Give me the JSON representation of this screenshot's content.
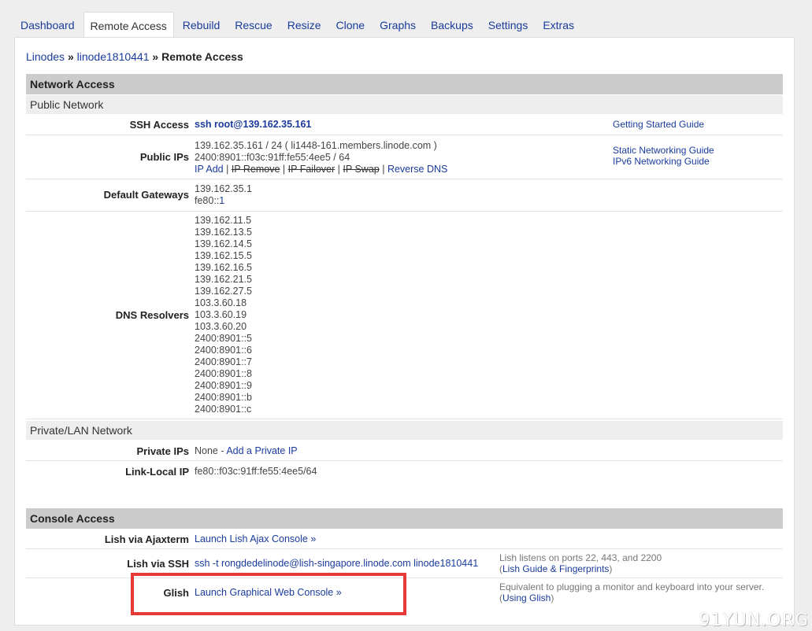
{
  "tabs": [
    "Dashboard",
    "Remote Access",
    "Rebuild",
    "Rescue",
    "Resize",
    "Clone",
    "Graphs",
    "Backups",
    "Settings",
    "Extras"
  ],
  "active_tab": "Remote Access",
  "breadcrumb": {
    "root": "Linodes",
    "sep1": "»",
    "linode": "linode1810441",
    "sep2": "»",
    "current": "Remote Access"
  },
  "network": {
    "header": "Network Access",
    "public_header": "Public Network",
    "ssh_access": {
      "label": "SSH Access",
      "value": "ssh root@139.162.35.161",
      "help": "Getting Started Guide"
    },
    "public_ips": {
      "label": "Public IPs",
      "ipv4": "139.162.35.161 / 24 ( li1448-161.members.linode.com )",
      "ipv6": "2400:8901::f03c:91ff:fe55:4ee5 / 64",
      "actions": {
        "ip_add": "IP Add",
        "ip_remove": "IP Remove",
        "ip_failover": "IP Failover",
        "ip_swap": "IP Swap",
        "reverse_dns": "Reverse DNS",
        "separator": "|"
      },
      "help1": "Static Networking Guide",
      "help2": "IPv6 Networking Guide"
    },
    "gateways": {
      "label": "Default Gateways",
      "ipv4": "139.162.35.1",
      "ipv6_prefix": "fe80::",
      "ipv6_link": "1"
    },
    "dns": {
      "label": "DNS Resolvers",
      "values": [
        "139.162.11.5",
        "139.162.13.5",
        "139.162.14.5",
        "139.162.15.5",
        "139.162.16.5",
        "139.162.21.5",
        "139.162.27.5",
        "103.3.60.18",
        "103.3.60.19",
        "103.3.60.20",
        "2400:8901::5",
        "2400:8901::6",
        "2400:8901::7",
        "2400:8901::8",
        "2400:8901::9",
        "2400:8901::b",
        "2400:8901::c"
      ]
    },
    "private_header": "Private/LAN Network",
    "private_ips": {
      "label": "Private IPs",
      "value": "None - ",
      "link": "Add a Private IP"
    },
    "link_local": {
      "label": "Link-Local IP",
      "value": "fe80::f03c:91ff:fe55:4ee5/64"
    }
  },
  "console": {
    "header": "Console Access",
    "ajaxterm": {
      "label": "Lish via Ajaxterm",
      "link": "Launch Lish Ajax Console »"
    },
    "ssh": {
      "label": "Lish via SSH",
      "link": "ssh -t rongdedelinode@lish-singapore.linode.com linode1810441",
      "note": "Lish listens on ports 22, 443, and 2200",
      "note_link": "Lish Guide & Fingerprints"
    },
    "glish": {
      "label": "Glish",
      "link": "Launch Graphical Web Console »",
      "note": "Equivalent to plugging a monitor and keyboard into your server.",
      "note_link": "Using Glish"
    }
  },
  "watermark": "91YUN.ORG",
  "colors": {
    "link": "#1a3b9c",
    "section_header": "#cccccc",
    "sub_header": "#eeeeee",
    "highlight": "#e53935"
  }
}
